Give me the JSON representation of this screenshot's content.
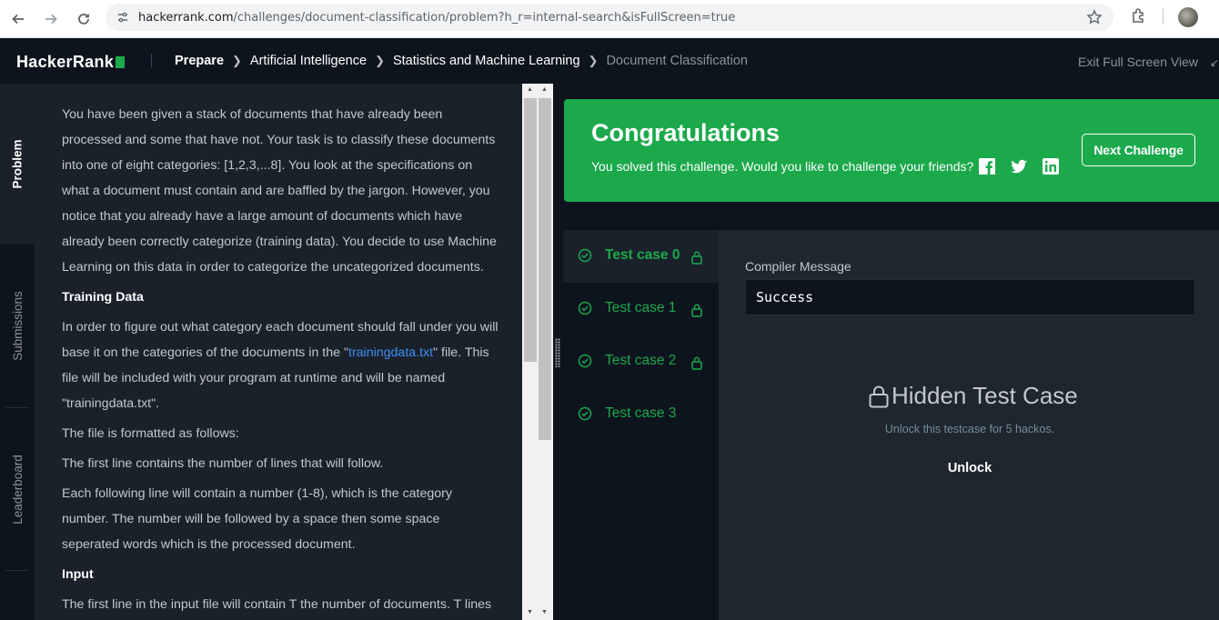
{
  "browser": {
    "url_domain": "hackerrank.com",
    "url_path": "/challenges/document-classification/problem?h_r=internal-search&isFullScreen=true"
  },
  "header": {
    "logo": "HackerRank",
    "breadcrumbs": [
      "Prepare",
      "Artificial Intelligence",
      "Statistics and Machine Learning",
      "Document Classification"
    ],
    "exit_fullscreen": "Exit Full Screen View"
  },
  "vtabs": [
    "Problem",
    "Submissions",
    "Leaderboard"
  ],
  "problem": {
    "intro": "You have been given a stack of documents that have already been processed and some that have not. Your task is to classify these documents into one of eight categories: [1,2,3,...8]. You look at the specifications on what a document must contain and are baffled by the jargon. However, you notice that you already have a large amount of documents which have already been correctly categorize (training data). You decide to use Machine Learning on this data in order to categorize the uncategorized documents.",
    "training_heading": "Training Data",
    "training_p1_before": "In order to figure out what category each document should fall under you will base it on the categories of the documents in the \"",
    "training_link": "trainingdata.txt",
    "training_p1_after": "\" file. This file will be included with your program at runtime and will be named \"trainingdata.txt\".",
    "format_line": "The file is formatted as follows:",
    "first_line": "The first line contains the number of lines that will follow.",
    "following_line": "Each following line will contain a number (1-8), which is the category number. The number will be followed by a space then some space seperated words which is the processed document.",
    "input_heading": "Input",
    "input_p": "The first line in the input file will contain T the number of documents. T lines"
  },
  "congrats": {
    "title": "Congratulations",
    "subtitle": "You solved this challenge. Would you like to challenge your friends?",
    "next_button": "Next Challenge",
    "social_icons": [
      "facebook-icon",
      "twitter-icon",
      "linkedin-icon"
    ]
  },
  "testcases": [
    {
      "label": "Test case 0",
      "locked": true
    },
    {
      "label": "Test case 1",
      "locked": true
    },
    {
      "label": "Test case 2",
      "locked": true
    },
    {
      "label": "Test case 3",
      "locked": false
    }
  ],
  "detail": {
    "compiler_label": "Compiler Message",
    "compiler_value": "Success",
    "hidden_title": "Hidden Test Case",
    "hidden_sub": "Unlock this testcase for 5 hackos.",
    "unlock": "Unlock"
  },
  "colors": {
    "brand_green": "#1ba94c",
    "bg_dark": "#0e141e",
    "panel": "#1a212b"
  }
}
